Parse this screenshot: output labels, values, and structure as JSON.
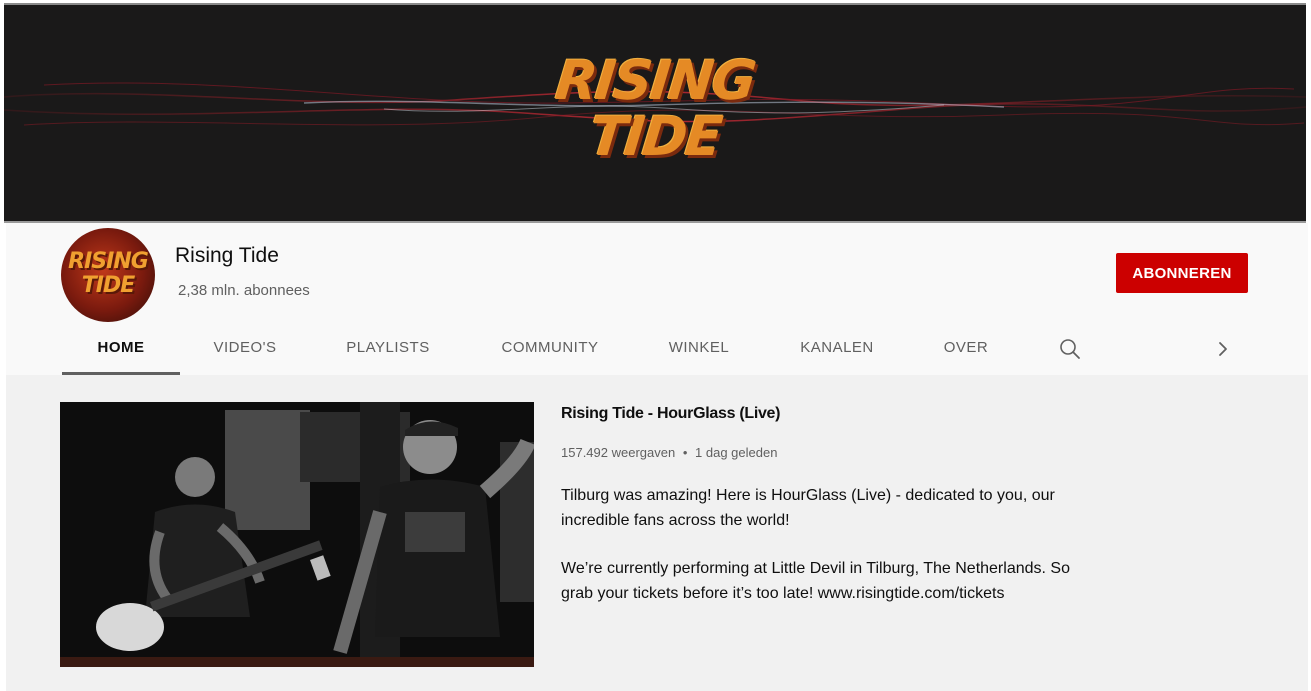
{
  "banner": {
    "logo_line1": "RISING",
    "logo_line2": "TIDE"
  },
  "channel": {
    "name": "Rising Tide",
    "subscribers": "2,38 mln. abonnees",
    "avatar_line1": "RISING",
    "avatar_line2": "TIDE",
    "subscribe_label": "ABONNEREN"
  },
  "tabs": [
    {
      "label": "HOME",
      "active": true
    },
    {
      "label": "VIDEO'S"
    },
    {
      "label": "PLAYLISTS"
    },
    {
      "label": "COMMUNITY"
    },
    {
      "label": "WINKEL"
    },
    {
      "label": "KANALEN"
    },
    {
      "label": "OVER"
    }
  ],
  "icons": {
    "search": "search-icon",
    "next": "chevron-right-icon"
  },
  "featured_video": {
    "title": "Rising Tide - HourGlass (Live)",
    "views": "157.492 weergaven",
    "separator": "•",
    "age": "1 dag geleden",
    "description_p1": "Tilburg was amazing! Here is HourGlass (Live) - dedicated to you, our incredible fans across the world!",
    "description_p2": "We’re currently performing at Little Devil in Tilburg, The Netherlands. So grab your tickets before it’s too late! www.risingtide.com/tickets"
  },
  "colors": {
    "subscribe": "#cc0000",
    "logo": "#e58a25",
    "banner_bg": "#1a1919",
    "content_bg": "#f1f1f1"
  }
}
